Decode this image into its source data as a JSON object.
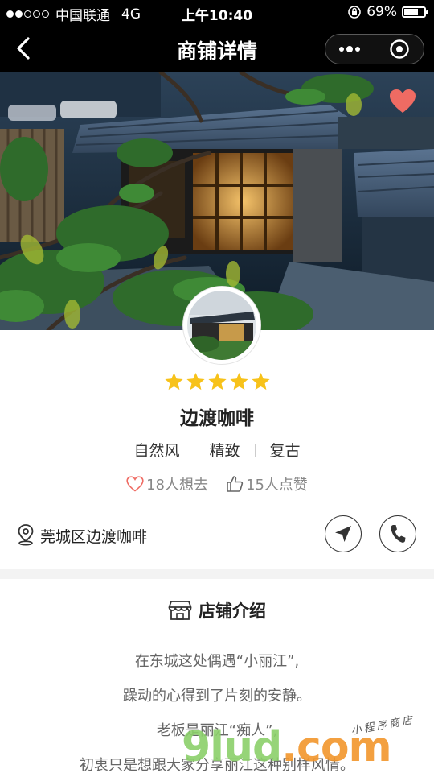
{
  "status_bar": {
    "carrier": "中国联通",
    "network": "4G",
    "time": "上午10:40",
    "battery": "69%",
    "battery_level": 0.69
  },
  "nav": {
    "title": "商铺详情"
  },
  "shop": {
    "rating": 5,
    "name": "边渡咖啡",
    "tags": [
      "自然风",
      "精致",
      "复古"
    ],
    "want_to_go": "18人想去",
    "likes": "15人点赞",
    "address": "莞城区边渡咖啡"
  },
  "intro": {
    "title": "店铺介绍",
    "lines": [
      "在东城这处偶遇“小丽江”,",
      "躁动的心得到了片刻的安静。",
      "老板是丽江“痴人”,",
      "初衷只是想跟大家分享丽江这种别样风情。"
    ]
  },
  "watermark": {
    "main": "9lud",
    "suffix": ".com",
    "sub": "小程序商店"
  },
  "colors": {
    "star": "#f7c21a",
    "heart": "#ef6b63",
    "bar": "#000000"
  }
}
